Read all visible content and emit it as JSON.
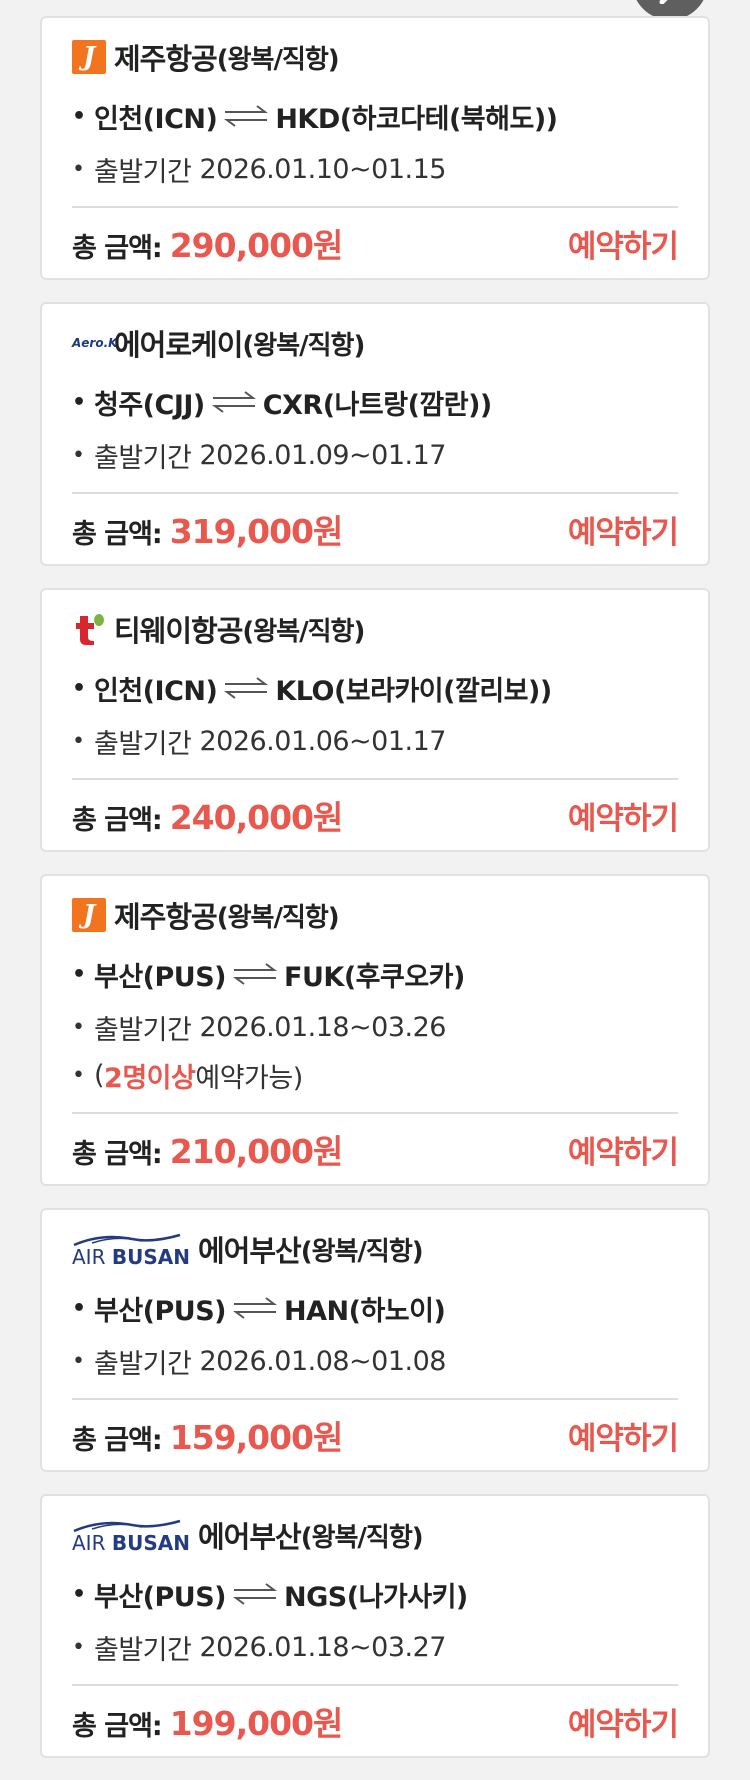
{
  "colors": {
    "accent": "#e8584e",
    "jeju": "#f3741f",
    "tway": "#d7262e",
    "airbusan": "#243b82"
  },
  "labels": {
    "total": "총 금액:",
    "book": "예약하기",
    "period_prefix": "출발기간",
    "bullet": "•"
  },
  "cards": [
    {
      "logo": "jeju-air-logo",
      "logo_text": "J",
      "airline": "제주항공",
      "sub": "(왕복/직항)",
      "from": "인천(ICN)",
      "to": "HKD(하코다테(북해도))",
      "period": "2026.01.10~01.15",
      "price": "290,000원"
    },
    {
      "logo": "aerok-logo",
      "logo_text": "Aero.K",
      "airline": "에어로케이",
      "sub": "(왕복/직항)",
      "from": "청주(CJJ)",
      "to": "CXR(나트랑(깜란))",
      "period": "2026.01.09~01.17",
      "price": "319,000원"
    },
    {
      "logo": "tway-logo",
      "logo_text": "t'",
      "airline": "티웨이항공",
      "sub": "(왕복/직항)",
      "from": "인천(ICN)",
      "to": "KLO(보라카이(깔리보))",
      "period": "2026.01.06~01.17",
      "price": "240,000원"
    },
    {
      "logo": "jeju-air-logo",
      "logo_text": "J",
      "airline": "제주항공",
      "sub": "(왕복/직항)",
      "from": "부산(PUS)",
      "to": "FUK(후쿠오카)",
      "period": "2026.01.18~03.26",
      "note": {
        "pre": "(",
        "highlight": "2명이상",
        "post": " 예약가능)"
      },
      "price": "210,000원"
    },
    {
      "logo": "airbusan-logo",
      "logo_text": "AIR BUSAN",
      "airline": "에어부산",
      "sub": "(왕복/직항)",
      "from": "부산(PUS)",
      "to": "HAN(하노이)",
      "period": "2026.01.08~01.08",
      "price": "159,000원"
    },
    {
      "logo": "airbusan-logo",
      "logo_text": "AIR BUSAN",
      "airline": "에어부산",
      "sub": "(왕복/직항)",
      "from": "부산(PUS)",
      "to": "NGS(나가사키)",
      "period": "2026.01.18~03.27",
      "price": "199,000원"
    }
  ]
}
